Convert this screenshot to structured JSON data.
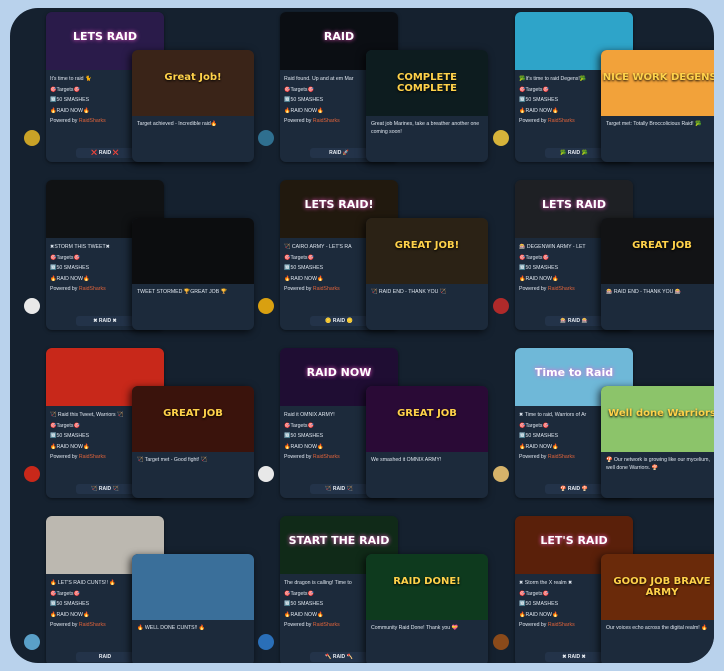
{
  "cards": [
    {
      "id": "c1",
      "banner": "LETS RAID",
      "over_banner": "Great Job!",
      "line1": "It's time to raid 🐈",
      "targets": "🎯Targets🎯",
      "smashes": "🔟50 SMASHES",
      "raid_now": "🔥RAID NOW🔥",
      "powered": "Powered by",
      "brand": "RaidSharks",
      "btn": "❌ RAID ❌",
      "caption": "Target achieved - Incredible raid🔥",
      "colors": {
        "card": "#1e2230",
        "banner": "#2a1b4a",
        "over": "#3a2418"
      }
    },
    {
      "id": "c2",
      "banner": "RAID",
      "over_banner": "COMPLETE COMPLETE",
      "line1": "Raid found. Up and at em Mar",
      "targets": "🎯Targets🎯",
      "smashes": "🔟50 SMASHES",
      "raid_now": "🔥RAID NOW🔥",
      "powered": "Powered by",
      "brand": "RaidSharks",
      "btn": "RAID 🚀",
      "caption": "Great job Marines, take a breather another one coming soon!",
      "colors": {
        "card": "#0f1419",
        "banner": "#0b0e13",
        "over": "#0d1c1f"
      }
    },
    {
      "id": "c3",
      "banner": "",
      "over_banner": "NICE WORK DEGENS!",
      "line1": "🥦It's time to raid Degens!🥦",
      "targets": "🎯Targets🎯",
      "smashes": "🔟50 SMASHES",
      "raid_now": "🔥RAID NOW🔥",
      "powered": "Powered by",
      "brand": "RaidSharks",
      "btn": "🥦 RAID 🥦",
      "caption": "Target met: Totally Broccolicious Raid! 🥦",
      "colors": {
        "card": "#2ea4c9",
        "banner": "#2ea4c9",
        "over": "#f2a23a"
      }
    },
    {
      "id": "c4",
      "banner": "",
      "over_banner": "",
      "line1": "✖STORM THIS TWEET✖",
      "targets": "🎯Targets🎯",
      "smashes": "🔟50 SMASHES",
      "raid_now": "🔥RAID NOW🔥",
      "powered": "Powered by",
      "brand": "RaidSharks",
      "btn": "✖ RAID ✖",
      "caption": "TWEET STORMED 🏆GREAT JOB 🏆",
      "colors": {
        "card": "#101214",
        "banner": "#101214",
        "over": "#0c0d0f"
      }
    },
    {
      "id": "c5",
      "banner": "LETS RAID!",
      "over_banner": "GREAT JOB!",
      "line1": "🏹 CAIRO ARMY - LET'S RA",
      "targets": "🎯Targets🎯",
      "smashes": "🔟50 SMASHES",
      "raid_now": "🔥RAID NOW🔥",
      "powered": "Powered by",
      "brand": "RaidSharks",
      "btn": "🪙 RAID 🪙",
      "caption": "🏹 RAID END - THANK YOU 🏹",
      "colors": {
        "card": "#1a1510",
        "banner": "#21190e",
        "over": "#2b2215"
      }
    },
    {
      "id": "c6",
      "banner": "LETS RAID",
      "over_banner": "GREAT JOB",
      "line1": "🎰 DEGENWIN ARMY - LET",
      "targets": "🎯Targets🎯",
      "smashes": "🔟50 SMASHES",
      "raid_now": "🔥RAID NOW🔥",
      "powered": "Powered by",
      "brand": "RaidSharks",
      "btn": "🎰 RAID 🎰",
      "caption": "🎰 RAID END - THANK YOU 🎰",
      "colors": {
        "card": "#16181b",
        "banner": "#1e2024",
        "over": "#121315"
      }
    },
    {
      "id": "c7",
      "banner": "",
      "over_banner": "GREAT JOB",
      "line1": "🏹 Raid this Tweet, Warriors 🏹",
      "targets": "🎯Targets🎯",
      "smashes": "🔟50 SMASHES",
      "raid_now": "🔥RAID NOW🔥",
      "powered": "Powered by",
      "brand": "RaidSharks",
      "btn": "🏹 RAID 🏹",
      "caption": "🏹 Target met - Good fight! 🏹",
      "colors": {
        "card": "#b01e14",
        "banner": "#c8281a",
        "over": "#3a130c"
      }
    },
    {
      "id": "c8",
      "banner": "RAID NOW",
      "over_banner": "GREAT JOB",
      "line1": "Raid it OMNIX ARMY!",
      "targets": "🎯Targets🎯",
      "smashes": "🔟50 SMASHES",
      "raid_now": "🔥RAID NOW🔥",
      "powered": "Powered by",
      "brand": "RaidSharks",
      "btn": "🏹 RAID 🏹",
      "caption": "We smashed it OMNIX ARMY!",
      "colors": {
        "card": "#1a0f2a",
        "banner": "#1f0d33",
        "over": "#2a0a36"
      }
    },
    {
      "id": "c9",
      "banner": "Time to Raid",
      "over_banner": "Well done Warriors",
      "line1": "✖ Time to raid, Warriors of Ar",
      "targets": "🎯Targets🎯",
      "smashes": "🔟50 SMASHES",
      "raid_now": "🔥RAID NOW🔥",
      "powered": "Powered by",
      "brand": "RaidSharks",
      "btn": "🍄 RAID 🍄",
      "caption": "🍄 Our network is growing like our mycelium, well done Warriors. 🍄",
      "colors": {
        "card": "#6fb8d8",
        "banner": "#6fb8d8",
        "over": "#8cc46a"
      }
    },
    {
      "id": "c10",
      "banner": "",
      "over_banner": "",
      "line1": "🔥 LET'S RAID CUNTS!! 🔥",
      "targets": "🎯Targets🎯",
      "smashes": "🔟50 SMASHES",
      "raid_now": "🔥RAID NOW🔥",
      "powered": "Powered by",
      "brand": "RaidSharks",
      "btn": "RAID",
      "caption": "🔥 WELL DONE CUNTS!! 🔥",
      "colors": {
        "card": "#bcb8b0",
        "banner": "#bcb8b0",
        "over": "#3a6f9a"
      }
    },
    {
      "id": "c11",
      "banner": "START THE RAID",
      "over_banner": "RAID DONE!",
      "line1": "The dragon is calling! Time to",
      "targets": "🎯Targets🎯",
      "smashes": "🔟50 SMASHES",
      "raid_now": "🔥RAID NOW🔥",
      "powered": "Powered by",
      "brand": "RaidSharks",
      "btn": "🪓 RAID 🪓",
      "caption": "Community Raid Done! Thank you 💝",
      "colors": {
        "card": "#0f2a18",
        "banner": "#102a18",
        "over": "#0e3a1e"
      }
    },
    {
      "id": "c12",
      "banner": "LET'S RAID",
      "over_banner": "GOOD JOB BRAVE ARMY",
      "line1": "✖ Storm the X realm ✖",
      "targets": "🎯Targets🎯",
      "smashes": "🔟50 SMASHES",
      "raid_now": "🔥RAID NOW🔥",
      "powered": "Powered by",
      "brand": "RaidSharks",
      "btn": "✖ RAID ✖",
      "caption": "Our voices echo across the digital realm! 🔥",
      "colors": {
        "card": "#3a1a0c",
        "banner": "#5a200a",
        "over": "#6a2a0a"
      }
    }
  ]
}
